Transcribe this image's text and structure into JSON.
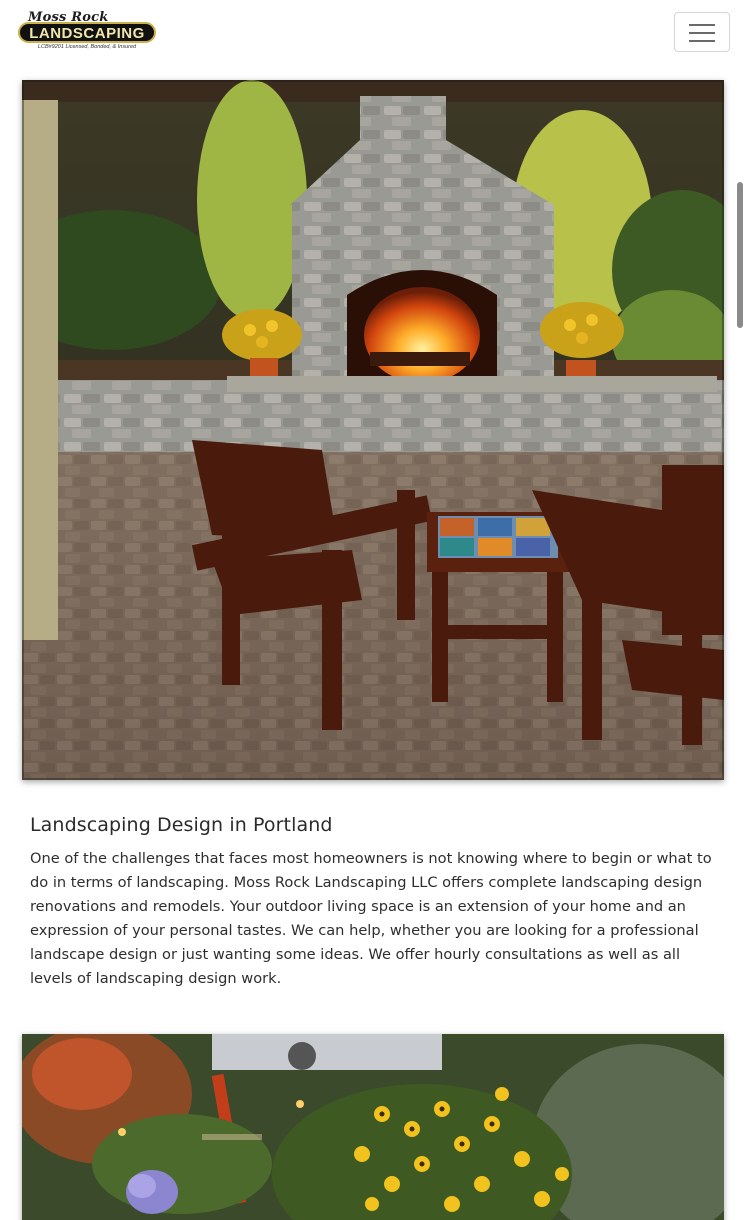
{
  "header": {
    "logo_top": "Moss Rock",
    "logo_main": "LANDSCAPING",
    "logo_sub": "LCB#9201 Licensed, Bonded, & Insured",
    "menu_icon": "hamburger-icon"
  },
  "hero_image": {
    "description_icon": "outdoor-fireplace-photo"
  },
  "content": {
    "heading": "Landscaping Design in Portland",
    "paragraph": "One of the challenges that faces most homeowners is not knowing where to begin or what to do in terms of landscaping. Moss Rock Landscaping LLC offers complete landscaping design renovations and remodels. Your outdoor living space is an extension of your home and an expression of your personal tastes. We can help, whether you are looking for a professional landscape design or just wanting some ideas. We offer hourly consultations as well as all levels of landscaping design work."
  },
  "second_image": {
    "description_icon": "garden-flowers-photo"
  },
  "colors": {
    "logo_plate": "#111111",
    "logo_trim": "#c8b04a",
    "text": "#2e2e2e"
  }
}
